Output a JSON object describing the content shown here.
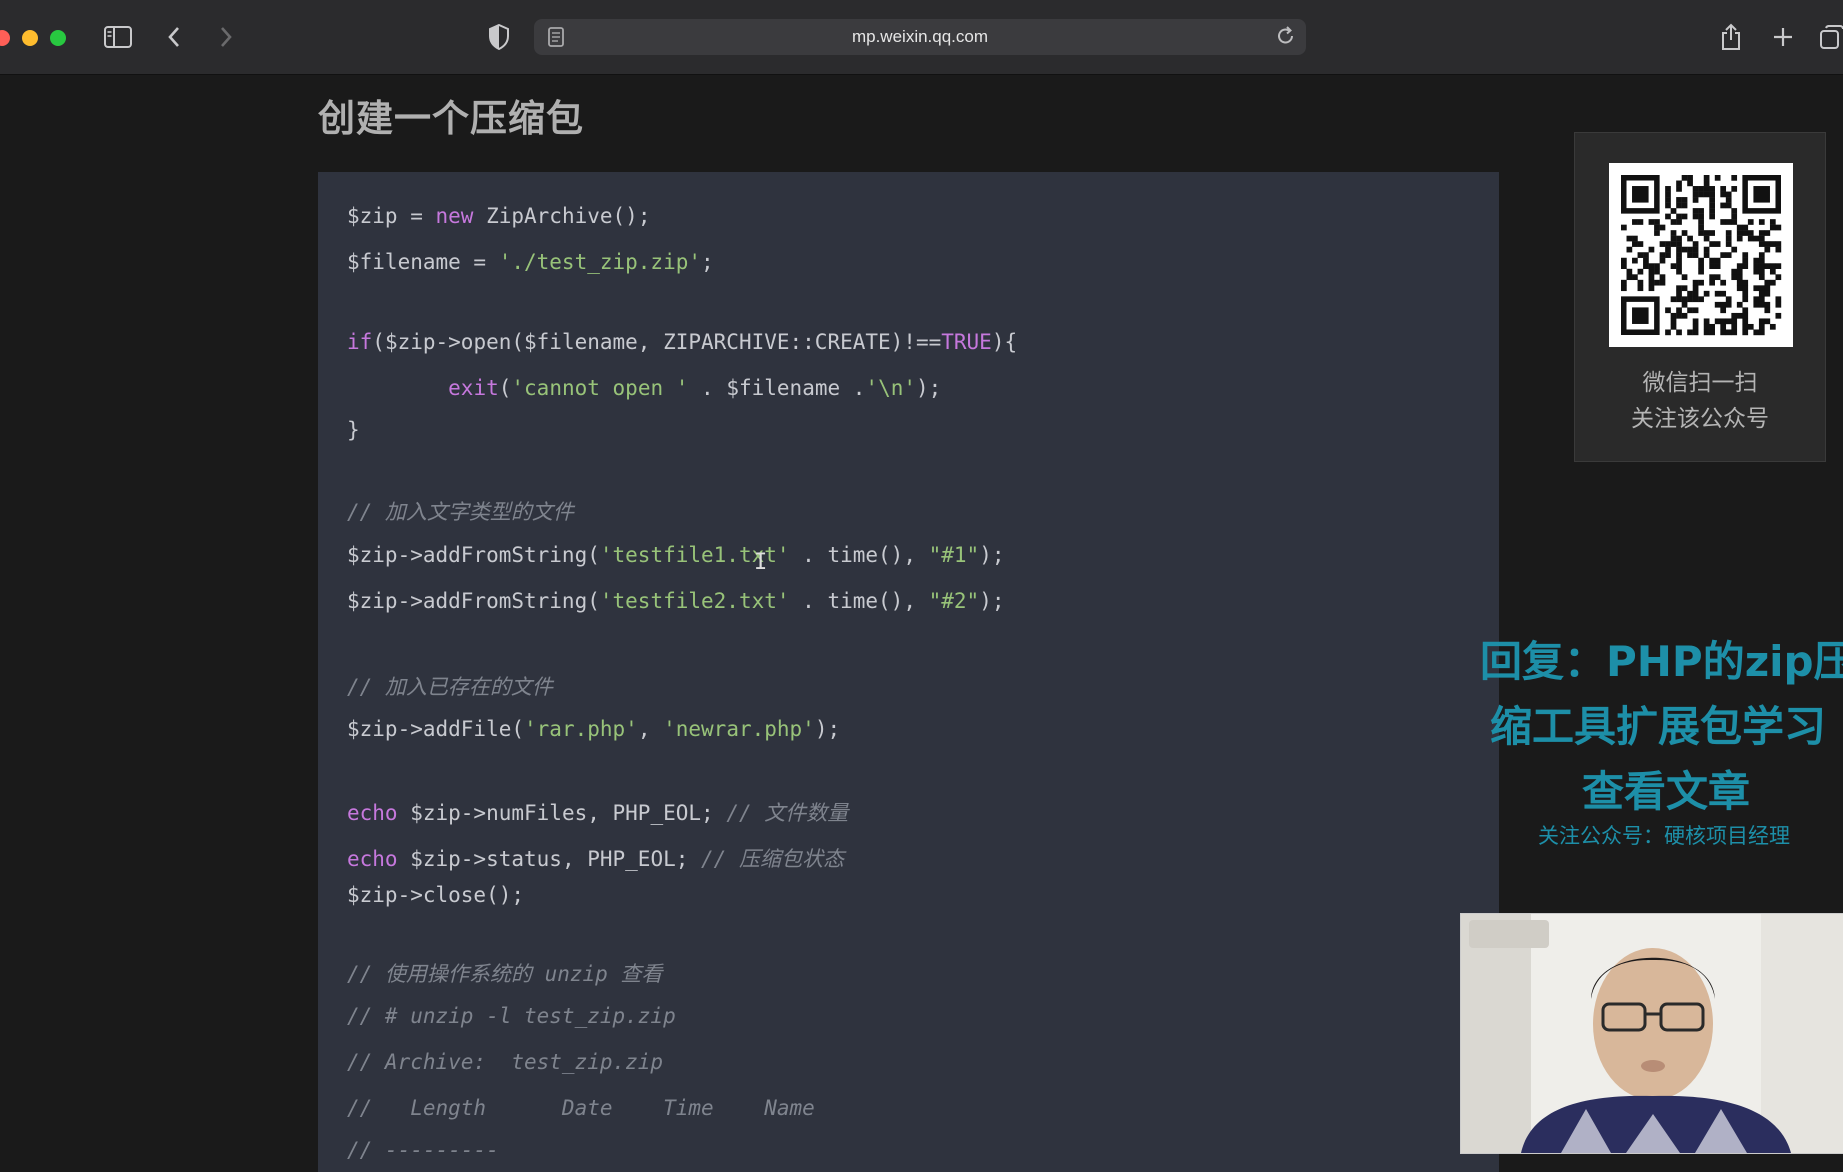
{
  "browser": {
    "url": "mp.weixin.qq.com"
  },
  "article": {
    "heading": "创建一个压缩包"
  },
  "code": [
    [
      {
        "t": "$zip = "
      },
      {
        "t": "new",
        "c": "kw"
      },
      {
        "t": " ZipArchive();"
      }
    ],
    [
      {
        "t": "$filename = "
      },
      {
        "t": "'./test_zip.zip'",
        "c": "str"
      },
      {
        "t": ";"
      }
    ],
    [
      {
        "t": "if",
        "c": "kw"
      },
      {
        "t": "($zip->open($filename, ZIPARCHIVE::CREATE)!=="
      },
      {
        "t": "TRUE",
        "c": "kw"
      },
      {
        "t": "){"
      }
    ],
    [
      {
        "t": "        "
      },
      {
        "t": "exit",
        "c": "kw"
      },
      {
        "t": "("
      },
      {
        "t": "'cannot open '",
        "c": "str"
      },
      {
        "t": " . $filename ."
      },
      {
        "t": "'\\n'",
        "c": "str"
      },
      {
        "t": ");"
      }
    ],
    [
      {
        "t": "}"
      }
    ],
    [
      {
        "t": "// 加入文字类型的文件",
        "c": "cm"
      }
    ],
    [
      {
        "t": "$zip->addFromString("
      },
      {
        "t": "'testfile1.txt'",
        "c": "str"
      },
      {
        "t": " . time(), "
      },
      {
        "t": "\"#1\"",
        "c": "str"
      },
      {
        "t": ");"
      }
    ],
    [
      {
        "t": "$zip->addFromString("
      },
      {
        "t": "'testfile2.txt'",
        "c": "str"
      },
      {
        "t": " . time(), "
      },
      {
        "t": "\"#2\"",
        "c": "str"
      },
      {
        "t": ");"
      }
    ],
    [
      {
        "t": "// 加入已存在的文件",
        "c": "cm"
      }
    ],
    [
      {
        "t": "$zip->addFile("
      },
      {
        "t": "'rar.php'",
        "c": "str"
      },
      {
        "t": ", "
      },
      {
        "t": "'newrar.php'",
        "c": "str"
      },
      {
        "t": ");"
      }
    ],
    [
      {
        "t": "echo",
        "c": "kw"
      },
      {
        "t": " $zip->numFiles, PHP_EOL; "
      },
      {
        "t": "// 文件数量",
        "c": "cm"
      }
    ],
    [
      {
        "t": "echo",
        "c": "kw"
      },
      {
        "t": " $zip->status, PHP_EOL; "
      },
      {
        "t": "// 压缩包状态",
        "c": "cm"
      }
    ],
    [
      {
        "t": "$zip->close();"
      }
    ],
    [
      {
        "t": "// 使用操作系统的 unzip 查看",
        "c": "cm"
      }
    ],
    [
      {
        "t": "// # unzip -l test_zip.zip",
        "c": "cm"
      }
    ],
    [
      {
        "t": "// Archive:  test_zip.zip",
        "c": "cm"
      }
    ],
    [
      {
        "t": "//   Length      Date    Time    Name",
        "c": "cm"
      }
    ],
    [
      {
        "t": "// ---------",
        "c": "cm"
      }
    ]
  ],
  "qr": {
    "caption_line1": "微信扫一扫",
    "caption_line2": "关注该公众号"
  },
  "overlay": {
    "line1": "回复：PHP的zip压",
    "line2": "缩工具扩展包学习",
    "line3": "查看文章",
    "follow": "关注公众号：硬核项目经理"
  },
  "colors": {
    "code_bg": "#2f333e",
    "keyword": "#c678dd",
    "string": "#98c379",
    "comment": "#7f848e",
    "overlay": "#1d8fa8"
  }
}
